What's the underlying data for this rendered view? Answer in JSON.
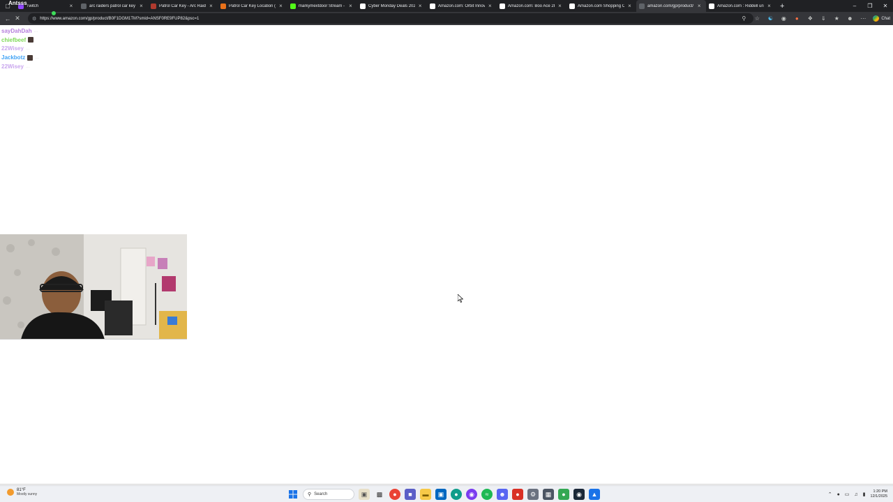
{
  "browser": {
    "tabs": [
      {
        "title": "Twitch",
        "color": "#9146ff",
        "active": false
      },
      {
        "title": "arc raiders patrol car key - S",
        "color": "#5f6368",
        "active": false
      },
      {
        "title": "Patrol Car Key - Arc Raiders",
        "color": "#b03a2e",
        "active": false
      },
      {
        "title": "Patrol Car Key Location (Arc",
        "color": "#e8711a",
        "active": false
      },
      {
        "title": "markymextdoor Stream - Wi",
        "color": "#53fc18",
        "active": false
      },
      {
        "title": "Cyber Monday Deals 2025",
        "color": "#ffffff",
        "active": false
      },
      {
        "title": "Amazon.com: Orbit Innovat",
        "color": "#ffffff",
        "active": false
      },
      {
        "title": "Amazon.com: Boo Ace 2B Pl",
        "color": "#ffffff",
        "active": false
      },
      {
        "title": "Amazon.com Shopping Cart",
        "color": "#ffffff",
        "active": false
      },
      {
        "title": "amazon.com/gp/product/B",
        "color": "#5f6368",
        "active": true
      },
      {
        "title": "Amazon.com : Riddell unise",
        "color": "#ffffff",
        "active": false
      }
    ],
    "url": "https://www.amazon.com/gp/product/B0F1DGM1TM?smid=ANSF0RE9FUP82&psc=1",
    "chat_label": "Chat"
  },
  "overlay": {
    "streamer_name": "Antsss"
  },
  "chat": {
    "messages": [
      {
        "user": "sayDahDah",
        "color": "#b57edc",
        "text": "..."
      },
      {
        "user": "chiefbeef",
        "color": "#7ed957",
        "text": ""
      },
      {
        "user": "22Wisey",
        "color": "#c9a6ee",
        "text": "..."
      },
      {
        "user": "Jackbotz",
        "color": "#3fa2f5",
        "text": "..."
      },
      {
        "user": "22Wisey",
        "color": "#c9a6ee",
        "text": "..."
      }
    ]
  },
  "taskbar": {
    "weather_temp": "81°F",
    "weather_cond": "Mostly sunny",
    "search_label": "Search",
    "time": "1:20 PM",
    "date": "12/1/2025"
  }
}
